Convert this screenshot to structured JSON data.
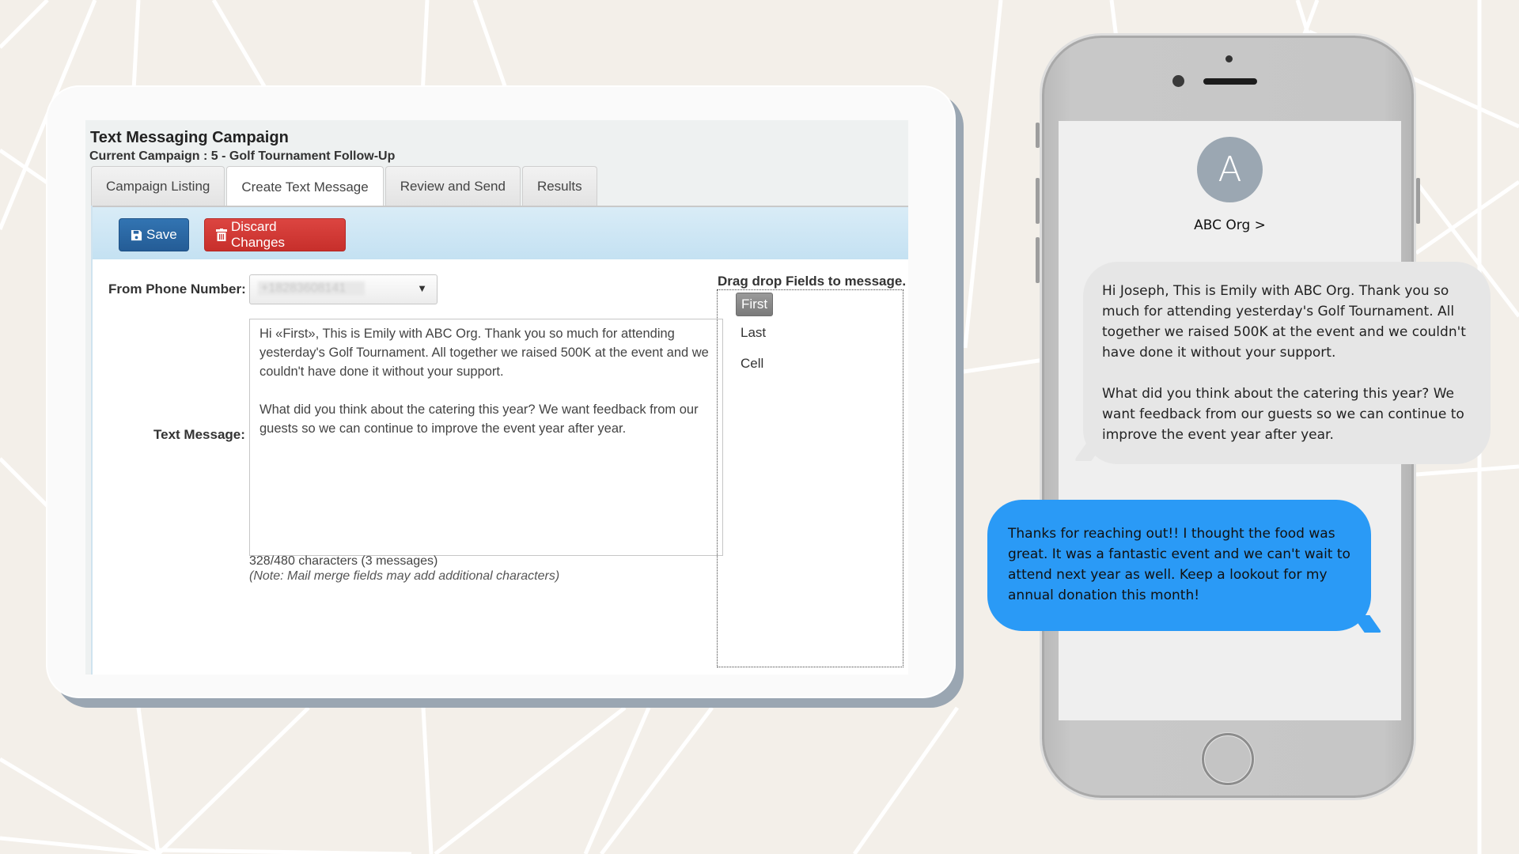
{
  "colors": {
    "background": "#f3efe9",
    "save_button": "#2c6aa8",
    "discard_button": "#d33b37",
    "toolbar": "#cde6f4",
    "incoming_bubble": "#e6e6e6",
    "outgoing_bubble": "#2a9af6",
    "avatar": "#9ba7b2"
  },
  "app": {
    "title": "Text Messaging Campaign",
    "subtitle": "Current Campaign : 5 - Golf Tournament Follow-Up",
    "tabs": [
      {
        "label": "Campaign Listing",
        "active": false
      },
      {
        "label": "Create Text Message",
        "active": true
      },
      {
        "label": "Review and Send",
        "active": false
      },
      {
        "label": "Results",
        "active": false
      }
    ],
    "toolbar": {
      "save_label": "Save",
      "save_icon": "floppy-disk-icon",
      "discard_label": "Discard Changes",
      "discard_icon": "trash-icon"
    },
    "form": {
      "from_phone_label": "From Phone Number:",
      "from_phone_value": "+18283608141",
      "text_message_label": "Text Message:",
      "text_message_value": "Hi «First», This is Emily with ABC Org. Thank you so much for attending yesterday's Golf Tournament. All together we raised 500K at the event and we couldn't have done it without your support.\n\nWhat did you think about the catering this year? We want feedback from our guests so we can continue to improve the event year after year.",
      "char_count": "328/480 characters (3 messages)",
      "note": "(Note: Mail merge fields may add additional characters)"
    },
    "merge_fields": {
      "title": "Drag drop Fields to message.",
      "items": [
        {
          "label": "First",
          "selected": true
        },
        {
          "label": "Last",
          "selected": false
        },
        {
          "label": "Cell",
          "selected": false
        }
      ]
    }
  },
  "phone": {
    "avatar_initial": "A",
    "contact_name": "ABC Org >",
    "incoming_message": "Hi Joseph, This is Emily with ABC Org. Thank you so much for attending yesterday's Golf Tournament. All together we raised 500K at the event and we couldn't have done it without your support.\n\nWhat did you think about the catering this year? We want feedback from our guests so we can continue to improve the event year after year.",
    "outgoing_message": "Thanks for reaching out!! I thought the food was great. It was a fantastic event and we can't wait to attend next year as well. Keep a lookout for my annual donation this month!"
  }
}
